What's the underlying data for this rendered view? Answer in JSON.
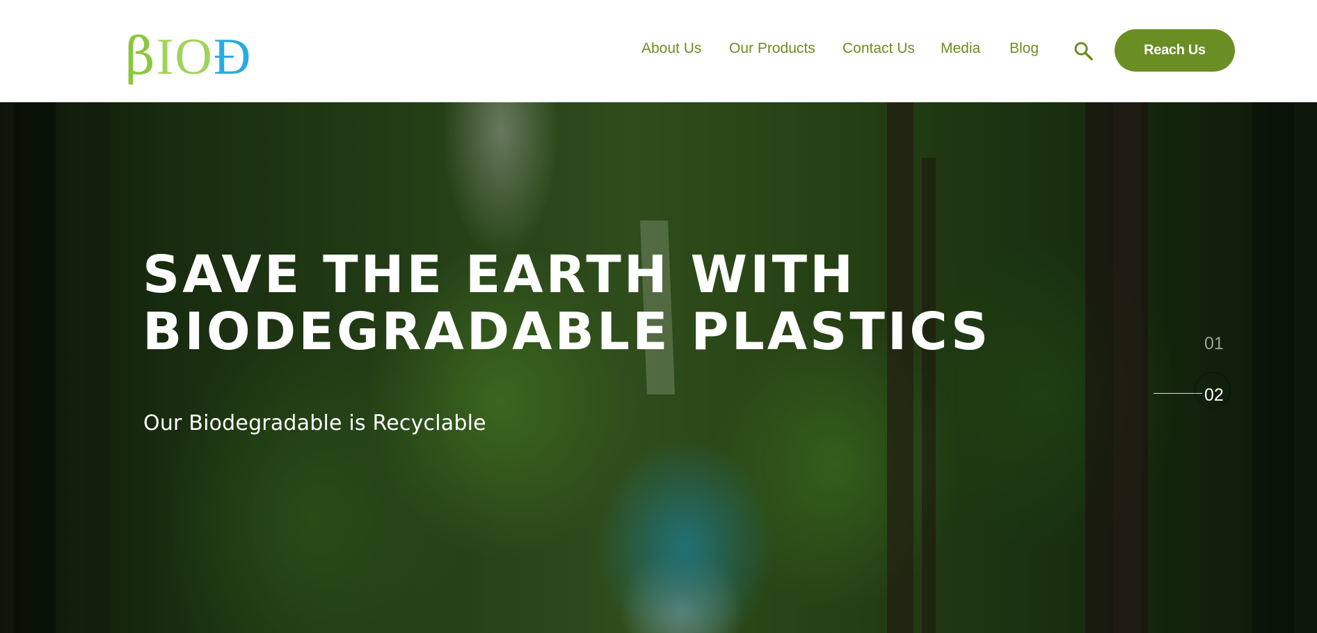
{
  "header": {
    "logo": {
      "text_part1": "β",
      "text_part2": "IO",
      "text_part3": "Ɖ"
    },
    "nav": [
      {
        "label": "About Us"
      },
      {
        "label": "Our Products"
      },
      {
        "label": "Contact Us"
      },
      {
        "label": "Media"
      },
      {
        "label": "Blog"
      }
    ],
    "search_icon": "search-icon",
    "cta_label": "Reach Us"
  },
  "hero": {
    "title_line1": "SAVE THE EARTH WITH",
    "title_line2": "BIODEGRADABLE PLASTICS",
    "subtitle": "Our Biodegradable is Recyclable",
    "slides": [
      {
        "label": "01",
        "active": false
      },
      {
        "label": "02",
        "active": true
      }
    ]
  },
  "colors": {
    "brand_green": "#6a8e23",
    "logo_green": "#8cc63f",
    "logo_blue": "#29abe2",
    "white": "#ffffff"
  }
}
